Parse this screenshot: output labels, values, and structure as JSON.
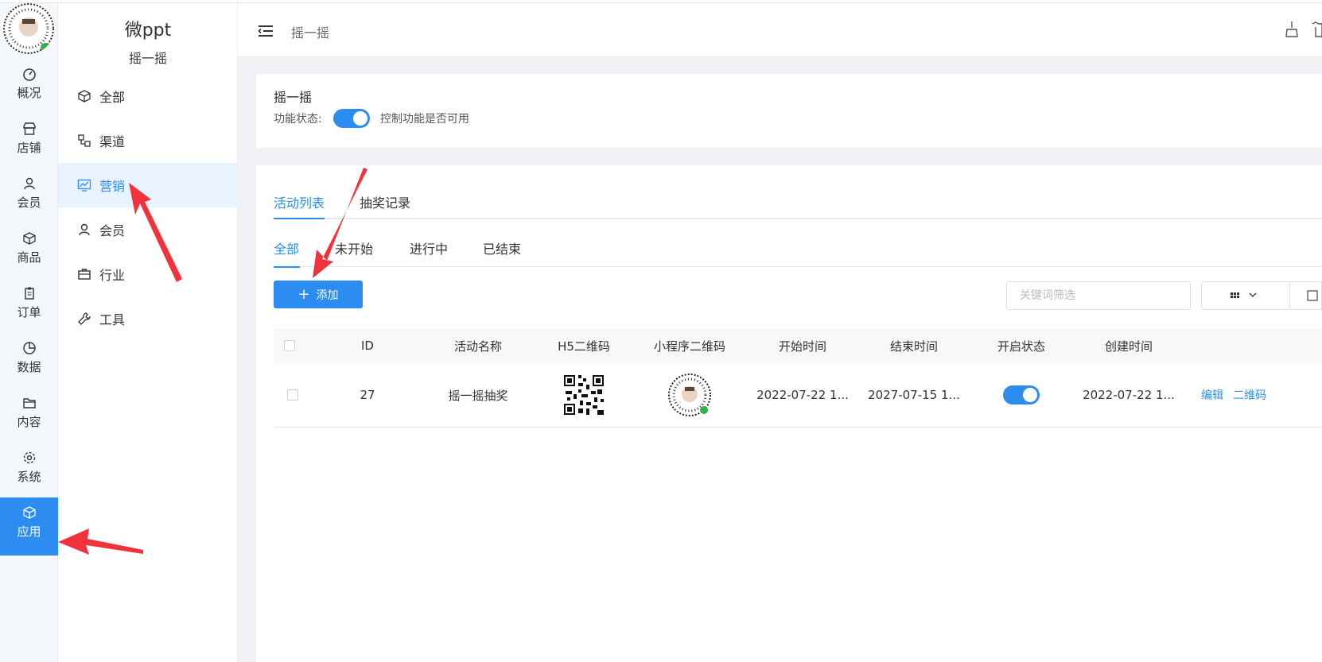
{
  "rail": {
    "items": [
      {
        "label": "概况",
        "icon": "dashboard-icon"
      },
      {
        "label": "店铺",
        "icon": "store-icon"
      },
      {
        "label": "会员",
        "icon": "user-icon"
      },
      {
        "label": "商品",
        "icon": "box-icon"
      },
      {
        "label": "订单",
        "icon": "clipboard-icon"
      },
      {
        "label": "数据",
        "icon": "pie-icon"
      },
      {
        "label": "内容",
        "icon": "folder-icon"
      },
      {
        "label": "系统",
        "icon": "gear-icon"
      },
      {
        "label": "应用",
        "icon": "cube-icon",
        "active": true
      }
    ]
  },
  "sidebar": {
    "title": "微ppt",
    "subtitle": "摇一摇",
    "items": [
      {
        "label": "全部",
        "icon": "cube-icon"
      },
      {
        "label": "渠道",
        "icon": "channel-icon"
      },
      {
        "label": "营销",
        "icon": "chart-line-icon",
        "active": true
      },
      {
        "label": "会员",
        "icon": "user-icon"
      },
      {
        "label": "行业",
        "icon": "briefcase-icon"
      },
      {
        "label": "工具",
        "icon": "wrench-icon"
      }
    ]
  },
  "topbar": {
    "breadcrumb": "摇一摇"
  },
  "feature": {
    "title": "摇一摇",
    "status_label": "功能状态:",
    "status_on": true,
    "status_desc": "控制功能是否可用"
  },
  "tabs": {
    "primary": [
      "活动列表",
      "抽奖记录"
    ],
    "secondary": [
      "全部",
      "未开始",
      "进行中",
      "已结束"
    ]
  },
  "toolbar": {
    "add_label": "添加",
    "search_placeholder": "关键词筛选"
  },
  "table": {
    "columns": [
      "ID",
      "活动名称",
      "H5二维码",
      "小程序二维码",
      "开始时间",
      "结束时间",
      "开启状态",
      "创建时间"
    ],
    "rows": [
      {
        "id": "27",
        "name": "摇一摇抽奖",
        "start": "2022-07-22 1...",
        "end": "2027-07-15 1...",
        "enabled": true,
        "created": "2022-07-22 1...",
        "actions": [
          "编辑",
          "二维码"
        ]
      }
    ]
  },
  "colors": {
    "primary": "#2d8cf0",
    "annotation": "#f0333a"
  }
}
